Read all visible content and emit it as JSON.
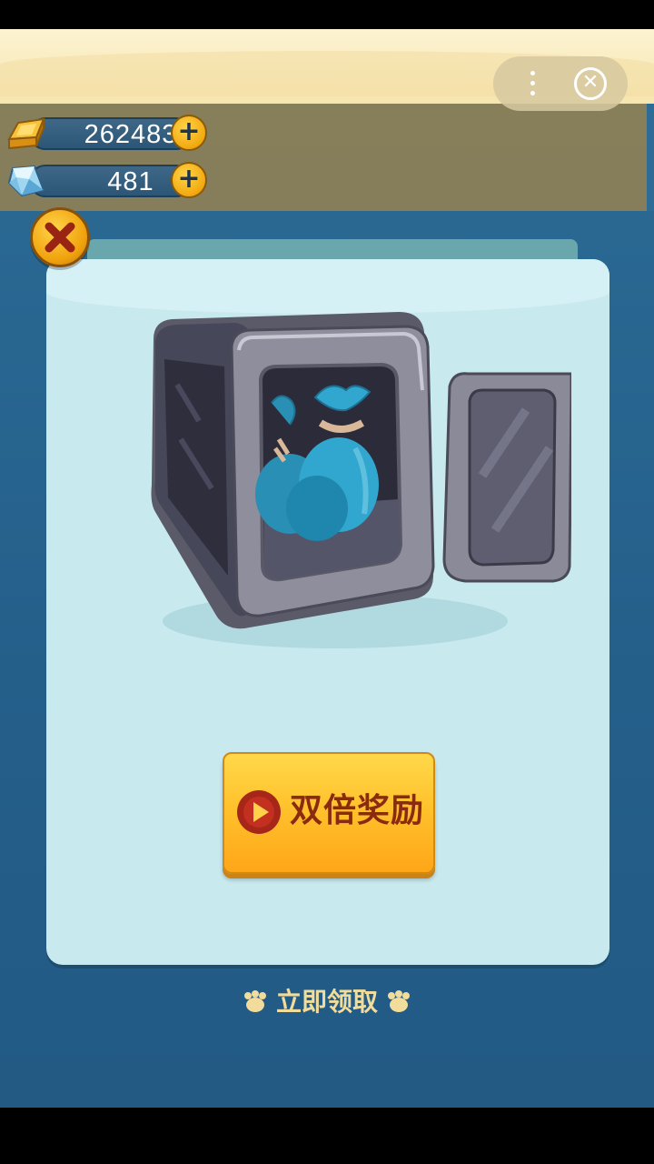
{
  "resources": {
    "gold": {
      "value": "262483",
      "icon": "gold-bar-icon"
    },
    "gems": {
      "value": "481",
      "icon": "diamond-icon"
    }
  },
  "miniprogram_capsule": {
    "more_icon": "more-dots-icon",
    "close_icon": "close-circle-icon"
  },
  "dialog": {
    "reward_image": "safe-with-money-bags",
    "double_reward_button": {
      "label": "双倍奖励",
      "icon": "play-icon"
    },
    "claim_now_label": "立即领取"
  },
  "colors": {
    "background": "#2c6c96",
    "dialog": "#c8e9ee",
    "button_yellow": "#ffc22c",
    "button_text": "#8a2a10",
    "claim_text": "#f1dc9c"
  }
}
